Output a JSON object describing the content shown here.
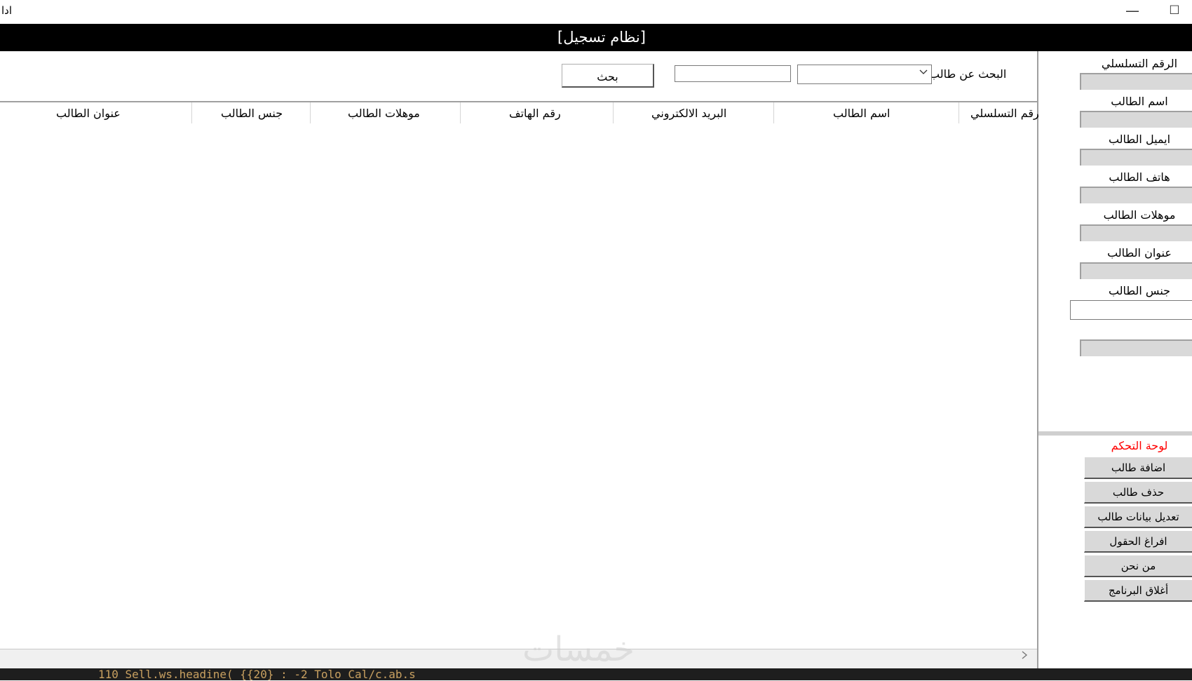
{
  "window": {
    "title": "ادا",
    "minimize_glyph": "—",
    "maximize_glyph": "☐"
  },
  "header": {
    "title": "[نظام تسجيل]"
  },
  "search": {
    "label": "البحث عن طالب",
    "select_value": "",
    "input_value": "",
    "button_label": "بحث"
  },
  "grid": {
    "columns": [
      "الرقم التسلسلي",
      "اسم الطالب",
      "البريد الالكتروني",
      "رقم الهاتف",
      "موهلات الطالب",
      "جنس الطالب",
      "عنوان الطالب"
    ],
    "rows": []
  },
  "form": {
    "fields": [
      "الرقم التسلسلي",
      "اسم الطالب",
      "ايميل الطالب",
      "هاتف الطالب",
      "موهلات الطالب",
      "عنوان الطالب",
      "جنس الطالب"
    ]
  },
  "control_panel": {
    "title": "لوحة التحكم",
    "buttons": [
      "اضافة طالب",
      "حذف طالب",
      "تعديل بيانات طالب",
      "افراغ الحقول",
      "من نحن",
      "أغلاق البرنامج"
    ]
  },
  "watermark": "خمسات",
  "taskbar_text": "110          Sell.ws.headine( {{20} : -2 Tolo    Cal/c.ab.s",
  "icons": [
    "chevron-down-icon",
    "chevron-right-icon"
  ],
  "colors": {
    "header_bg": "#000000",
    "header_text": "#ffffff",
    "control_title": "#ff0000",
    "button_bg": "#d9d9d9"
  }
}
